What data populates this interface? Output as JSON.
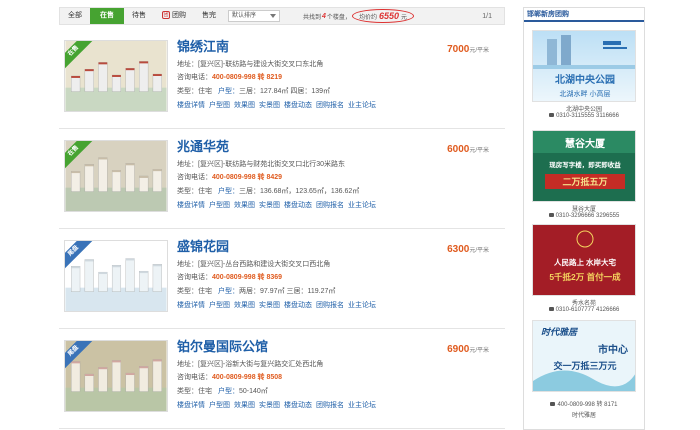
{
  "filters": {
    "tabs": [
      "全部",
      "在售",
      "待售",
      "团购",
      "售完"
    ],
    "active": "在售",
    "sort": "默认排序",
    "summary_pre": "共找到",
    "count": "4",
    "summary_mid": "个楼盘，",
    "avg_label": "均价约",
    "avg_price": "6550",
    "avg_unit": "元",
    "pager": "1/1"
  },
  "listings": [
    {
      "name": "锦绣江南",
      "badge": "在售",
      "address_label": "地址：",
      "address": "[复兴区]-联纺路与建设大街交叉口东北角",
      "phone_label": "咨询电话：",
      "phone": "400-0809-998 转 8219",
      "type_label": "类型：",
      "type": "住宅",
      "layout_label": "户型：",
      "layout": "三居：127.84㎡  四居：139㎡",
      "links": [
        "楼盘详情",
        "户型图",
        "效果图",
        "实景图",
        "楼盘动态",
        "团购报名",
        "业主论坛"
      ],
      "price": "7000",
      "price_unit": "元/平米"
    },
    {
      "name": "兆通华苑",
      "badge": "在售",
      "address_label": "地址：",
      "address": "[复兴区]-联纺路与财苑北街交叉口北行30米路东",
      "phone_label": "咨询电话：",
      "phone": "400-0809-998 转 8429",
      "type_label": "类型：",
      "type": "住宅",
      "layout_label": "户型：",
      "layout": "三居：136.68㎡，123.65㎡，136.62㎡",
      "links": [
        "楼盘详情",
        "户型图",
        "效果图",
        "实景图",
        "楼盘动态",
        "团购报名",
        "业主论坛"
      ],
      "price": "6000",
      "price_unit": "元/平米"
    },
    {
      "name": "盛锦花园",
      "badge": "尾盘",
      "address_label": "地址：",
      "address": "[复兴区]-丛台西路和建设大街交叉口西北角",
      "phone_label": "咨询电话：",
      "phone": "400-0809-998 转 8369",
      "type_label": "类型：",
      "type": "住宅",
      "layout_label": "户型：",
      "layout": "两居：97.97㎡  三居：119.27㎡",
      "links": [
        "楼盘详情",
        "户型图",
        "效果图",
        "实景图",
        "楼盘动态",
        "团购报名",
        "业主论坛"
      ],
      "price": "6300",
      "price_unit": "元/平米"
    },
    {
      "name": "铂尔曼国际公馆",
      "badge": "尾盘",
      "address_label": "地址：",
      "address": "[复兴区]-浴新大街与复兴路交汇处西北角",
      "phone_label": "咨询电话：",
      "phone": "400-0809-998 转 8508",
      "type_label": "类型：",
      "type": "住宅",
      "layout_label": "户型：",
      "layout": "50-140㎡",
      "links": [
        "楼盘详情",
        "户型图",
        "效果图",
        "实景图",
        "楼盘动态",
        "团购报名",
        "业主论坛"
      ],
      "price": "6900",
      "price_unit": "元/平米"
    }
  ],
  "sidebar": {
    "title": "邯郸新房团购",
    "ads": [
      {
        "headline": "北湖中央公园",
        "tagline": "北湖水畔  小高层",
        "name": "北湖中央公园",
        "phone": "0310-3115555 3116666",
        "colors": [
          "#cfe6f7",
          "#2a6fb3"
        ]
      },
      {
        "headline": "慧谷大厦",
        "tagline1": "现房写字楼，即买即收益",
        "tagline2": "二万抵五万",
        "name": "慧谷大厦",
        "phone": "0310-3296666 3296555",
        "colors": [
          "#1d6e4f",
          "#e0b63a"
        ]
      },
      {
        "headline": "人民路上  水岸大宅",
        "tagline": "5千抵2万  首付一成",
        "name": "秀水名苑",
        "phone": "0310-6107777 4126666",
        "colors": [
          "#a31d26",
          "#f4d35e"
        ]
      },
      {
        "headline": "时代雅居",
        "tagline1": "市中心",
        "tagline2": "交一万抵三万元",
        "name": "时代雅居",
        "phone": "400-0809-998 转 8171",
        "colors": [
          "#e7f3f9",
          "#1b4f8a"
        ]
      }
    ]
  },
  "colors": {
    "accent": "#46a331",
    "link": "#1f5fa8",
    "price": "#e05b1f"
  }
}
